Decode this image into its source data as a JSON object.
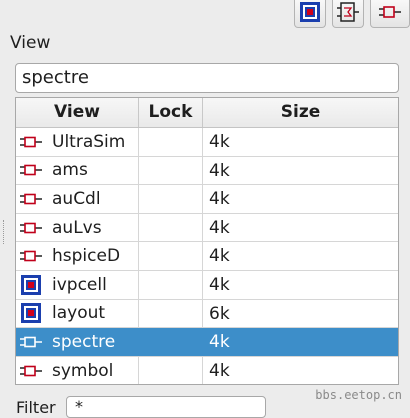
{
  "toolbar": {
    "buttons": [
      {
        "icon": "layout-cell-icon"
      },
      {
        "icon": "schematic-symbol-icon"
      },
      {
        "icon": "symbol-view-icon"
      }
    ]
  },
  "view_section": {
    "label": "View",
    "current_value": "spectre"
  },
  "table": {
    "headers": [
      "View",
      "Lock",
      "Size"
    ],
    "rows": [
      {
        "icon": "symbol-view-icon",
        "view": "UltraSim",
        "lock": "",
        "size": "4k"
      },
      {
        "icon": "symbol-view-icon",
        "view": "ams",
        "lock": "",
        "size": "4k"
      },
      {
        "icon": "symbol-view-icon",
        "view": "auCdl",
        "lock": "",
        "size": "4k"
      },
      {
        "icon": "symbol-view-icon",
        "view": "auLvs",
        "lock": "",
        "size": "4k"
      },
      {
        "icon": "symbol-view-icon",
        "view": "hspiceD",
        "lock": "",
        "size": "4k"
      },
      {
        "icon": "layout-cell-icon",
        "view": "ivpcell",
        "lock": "",
        "size": "4k"
      },
      {
        "icon": "layout-cell-icon",
        "view": "layout",
        "lock": "",
        "size": "6k"
      },
      {
        "icon": "symbol-view-icon",
        "view": "spectre",
        "lock": "",
        "size": "4k",
        "selected": true
      },
      {
        "icon": "symbol-view-icon",
        "view": "symbol",
        "lock": "",
        "size": "4k"
      }
    ]
  },
  "filter": {
    "label": "Filter",
    "value": "*"
  },
  "watermark": "bbs.eetop.cn",
  "colors": {
    "selection": "#3d8ec9",
    "symbol_icon": "#c0001a",
    "layout_icon": "#1b3fae"
  }
}
